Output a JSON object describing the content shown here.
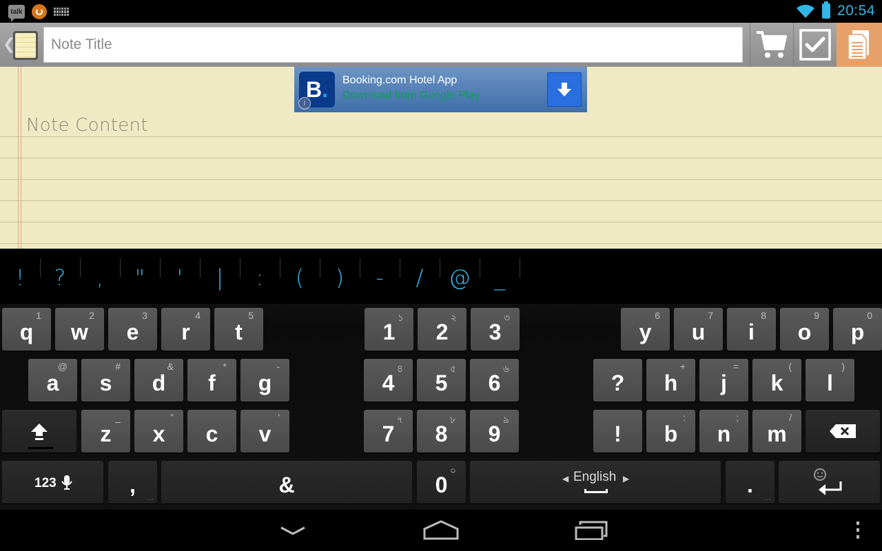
{
  "status_bar": {
    "notification_icons": [
      "talk-icon",
      "orange-app-icon",
      "keyboard-icon"
    ],
    "talk_label": "talk",
    "time": "20:54",
    "wifi": "wifi-icon",
    "battery": "battery-icon"
  },
  "action_bar": {
    "up_glyph": "❮",
    "title_placeholder": "Note Title",
    "title_value": "",
    "actions": [
      "shopping-cart",
      "checklist",
      "notes"
    ]
  },
  "ad": {
    "logo_letter": "B",
    "logo_dot": ".",
    "info_glyph": "i",
    "title": "Booking.com Hotel App",
    "subtitle": "Download from Google Play",
    "colors": {
      "subtitle": "#0f9d58",
      "button": "#2a6fdf"
    }
  },
  "note": {
    "content_placeholder": "Note Content",
    "content_value": ""
  },
  "keyboard": {
    "suggestions": [
      "!",
      "?",
      ",",
      "\"",
      "'",
      "|",
      ":",
      "(",
      ")",
      "-",
      "/",
      "@",
      "_"
    ],
    "row1_left": [
      {
        "label": "q",
        "sec": "1"
      },
      {
        "label": "w",
        "sec": "2"
      },
      {
        "label": "e",
        "sec": "3"
      },
      {
        "label": "r",
        "sec": "4"
      },
      {
        "label": "t",
        "sec": "5"
      }
    ],
    "row1_num": [
      {
        "label": "1",
        "sec": "১"
      },
      {
        "label": "2",
        "sec": "২"
      },
      {
        "label": "3",
        "sec": "৩"
      }
    ],
    "row1_right": [
      {
        "label": "y",
        "sec": "6"
      },
      {
        "label": "u",
        "sec": "7"
      },
      {
        "label": "i",
        "sec": "8"
      },
      {
        "label": "o",
        "sec": "9"
      },
      {
        "label": "p",
        "sec": "0"
      }
    ],
    "row2_left": [
      {
        "label": "a",
        "sec": "@"
      },
      {
        "label": "s",
        "sec": "#"
      },
      {
        "label": "d",
        "sec": "&"
      },
      {
        "label": "f",
        "sec": "*"
      },
      {
        "label": "g",
        "sec": "-"
      }
    ],
    "row2_num": [
      {
        "label": "4",
        "sec": "৪"
      },
      {
        "label": "5",
        "sec": "৫"
      },
      {
        "label": "6",
        "sec": "৬"
      }
    ],
    "row2_right": [
      {
        "label": "?",
        "sec": ""
      },
      {
        "label": "h",
        "sec": "+"
      },
      {
        "label": "j",
        "sec": "="
      },
      {
        "label": "k",
        "sec": "("
      },
      {
        "label": "l",
        "sec": ")"
      }
    ],
    "row3_left": [
      {
        "label": "z",
        "sec": "_"
      },
      {
        "label": "x",
        "sec": "\""
      },
      {
        "label": "c",
        "sec": ""
      },
      {
        "label": "v",
        "sec": "'"
      }
    ],
    "row3_num": [
      {
        "label": "7",
        "sec": "৭"
      },
      {
        "label": "8",
        "sec": "৮"
      },
      {
        "label": "9",
        "sec": "৯"
      }
    ],
    "row3_right": [
      {
        "label": "!",
        "sec": ""
      },
      {
        "label": "b",
        "sec": ":"
      },
      {
        "label": "n",
        "sec": ";"
      },
      {
        "label": "m",
        "sec": "/"
      }
    ],
    "symbols_key": "123",
    "comma_key": ",",
    "amp_key": "&",
    "zero_key": {
      "label": "0",
      "sec": "০"
    },
    "space_language": "English",
    "period_key": ".",
    "more_glyph": "…"
  },
  "nav_bar": {
    "buttons": [
      "back-hide-keyboard",
      "home",
      "recent-apps",
      "menu"
    ]
  }
}
